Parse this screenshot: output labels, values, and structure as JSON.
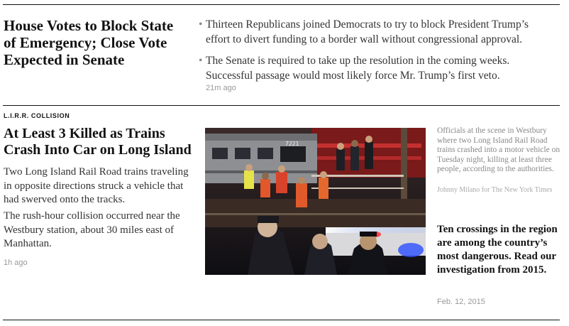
{
  "story1": {
    "headline": "House Votes to Block State of Emergency; Close Vote Expected in Senate",
    "bullets": [
      "Thirteen Republicans joined Democrats to try to block President Trump’s effort to divert funding to a border wall without congressional approval.",
      "The Senate is required to take up the resolution in the coming weeks. Successful passage would most likely force Mr. Trump’s first veto."
    ],
    "timestamp": "21m ago"
  },
  "story2": {
    "kicker": "L.I.R.R. COLLISION",
    "headline": "At Least 3 Killed as Trains Crash Into Car on Long Island",
    "paragraphs": [
      "Two Long Island Rail Road trains traveling in opposite directions struck a vehicle that had swerved onto the tracks.",
      "The rush-hour collision occurred near the Westbury station, about 30 miles east of Manhattan."
    ],
    "timestamp": "1h ago",
    "photo": {
      "caption": "Officials at the scene in Westbury where two Long Island Rail Road trains crashed into a motor vehicle on Tuesday night, killing at least three people, according to the authorities.",
      "credit": "Johnny Milano for The New York Times",
      "train_label": "7221"
    },
    "related": {
      "headline": "Ten crossings in the region are among the country’s most dangerous. Read our investigation from 2015.",
      "date": "Feb. 12, 2015"
    }
  }
}
